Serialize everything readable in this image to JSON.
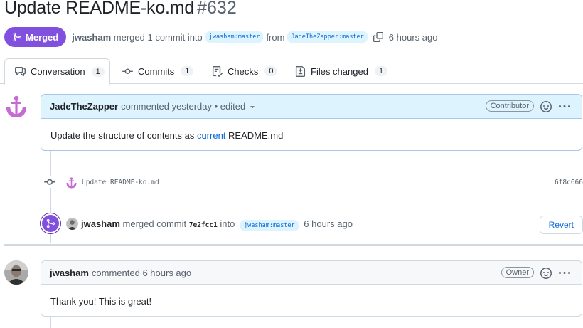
{
  "header": {
    "title": "Update README-ko.md",
    "number": "#632"
  },
  "meta": {
    "status": "Merged",
    "user": "jwasham",
    "merged_text": "merged 1 commit into",
    "base_branch": "jwasham:master",
    "from_text": "from",
    "head_branch": "JadeTheZapper:master",
    "time": "6 hours ago"
  },
  "tabs": [
    {
      "label": "Conversation",
      "count": "1"
    },
    {
      "label": "Commits",
      "count": "1"
    },
    {
      "label": "Checks",
      "count": "0"
    },
    {
      "label": "Files changed",
      "count": "1"
    }
  ],
  "comment1": {
    "author": "JadeTheZapper",
    "sub": "commented yesterday • edited",
    "role": "Contributor",
    "body_before": "Update the structure of contents as ",
    "body_link": "current",
    "body_after": " README.md"
  },
  "commit": {
    "message": "Update README-ko.md",
    "sha": "6f8c666"
  },
  "merge_event": {
    "user": "jwasham",
    "text1": "merged commit",
    "sha": "7e2fcc1",
    "text2": "into",
    "branch": "jwasham:master",
    "time": "6 hours ago",
    "revert_label": "Revert"
  },
  "comment2": {
    "author": "jwasham",
    "sub": "commented 6 hours ago",
    "role": "Owner",
    "body": "Thank you! This is great!"
  },
  "colors": {
    "merged": "#8250df",
    "link": "#0969da",
    "comment_head_highlight": "#ddf4ff"
  }
}
